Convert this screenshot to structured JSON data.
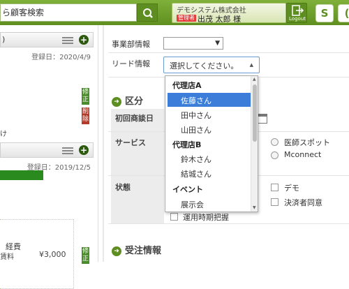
{
  "header": {
    "search_value": "ら顧客検索",
    "company": "デモシステム株式会社",
    "role_badge": "管理者",
    "user_name": "出茂 太郎 様",
    "logout_label": "Logout",
    "btn1_glyph": "S",
    "btn2_glyph": "(",
    "accent_color": "#6a9a28"
  },
  "left": {
    "card1": {
      "title": ")",
      "reg_date": "登録日：2020/4/9",
      "badges": [
        "修正",
        "削除"
      ],
      "note": "け"
    },
    "card2": {
      "reg_date": "登録日：2019/12/5"
    },
    "expense_label": "経費",
    "fee_label": "賃料",
    "amount": "¥3,000",
    "badge3": "修正"
  },
  "form": {
    "dept_label": "事業部情報",
    "dept_value": "▼",
    "lead_label": "リード情報",
    "lead_placeholder": "選択してください。",
    "section1_title": "区分",
    "first_meeting_label": "初回商談日",
    "service_label": "サービス",
    "status_label": "状態",
    "options": {
      "doctor_spot": "医師スポット",
      "mconnect": "Mconnect",
      "demo": "デモ",
      "payer_agree": "決済者同意",
      "operation_time": "運用時期把握"
    },
    "section2_title": "受注情報"
  },
  "dropdown": {
    "groups": [
      {
        "label": "代理店A",
        "items": [
          "佐藤さん",
          "田中さん",
          "山田さん"
        ]
      },
      {
        "label": "代理店B",
        "items": [
          "鈴木さん",
          "結城さん"
        ]
      },
      {
        "label": "イベント",
        "items": [
          "展示会"
        ]
      }
    ],
    "selected": "佐藤さん",
    "selected_color": "#3b7dd8"
  }
}
